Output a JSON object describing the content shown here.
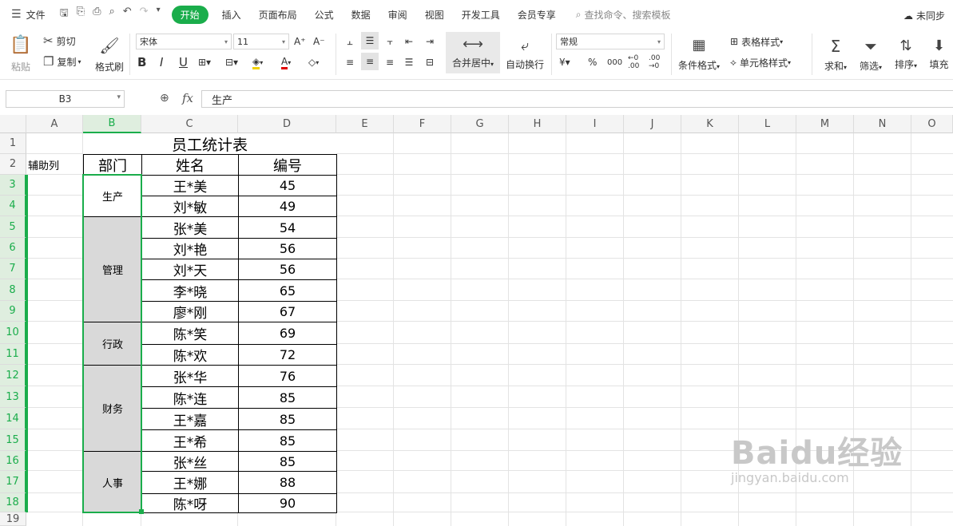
{
  "menubar": {
    "file": "文件",
    "tabs": [
      "开始",
      "插入",
      "页面布局",
      "公式",
      "数据",
      "审阅",
      "视图",
      "开发工具",
      "会员专享"
    ],
    "search": "查找命令、搜索模板",
    "sync": "未同步"
  },
  "ribbon": {
    "paste": "粘贴",
    "cut": "剪切",
    "copy": "复制",
    "format_painter": "格式刷",
    "font_name": "宋体",
    "font_size": "11",
    "merge_center": "合并居中",
    "wrap": "自动换行",
    "number_format": "常规",
    "table_style": "表格样式",
    "cond_format": "条件格式",
    "cell_style": "单元格样式",
    "sum": "求和",
    "filter": "筛选",
    "sort": "排序",
    "fill": "填充"
  },
  "formula_bar": {
    "name_box": "B3",
    "fx": "fx",
    "content": "生产"
  },
  "columns": [
    "A",
    "B",
    "C",
    "D",
    "E",
    "F",
    "G",
    "H",
    "I",
    "J",
    "K",
    "L",
    "M",
    "N",
    "O"
  ],
  "rows": [
    "1",
    "2",
    "3",
    "4",
    "5",
    "6",
    "7",
    "8",
    "9",
    "10",
    "11",
    "12",
    "13",
    "14",
    "15",
    "16",
    "17",
    "18",
    "19"
  ],
  "sheet": {
    "title": "员工统计表",
    "helper_label": "辅助列",
    "headers": [
      "部门",
      "姓名",
      "编号"
    ],
    "departments": [
      "生产",
      "管理",
      "行政",
      "财务",
      "人事"
    ],
    "names": [
      "王*美",
      "刘*敏",
      "张*美",
      "刘*艳",
      "刘*天",
      "李*晓",
      "廖*刚",
      "陈*笑",
      "陈*欢",
      "张*华",
      "陈*连",
      "王*嘉",
      "王*希",
      "张*丝",
      "王*娜",
      "陈*呀"
    ],
    "ids": [
      "45",
      "49",
      "54",
      "56",
      "56",
      "65",
      "67",
      "69",
      "72",
      "76",
      "85",
      "85",
      "85",
      "85",
      "88",
      "90"
    ]
  },
  "watermark": {
    "brand": "Baidu经验",
    "url": "jingyan.baidu.com"
  },
  "colors": {
    "accent": "#1aad4b",
    "selection_fill": "#d9d9d9"
  }
}
